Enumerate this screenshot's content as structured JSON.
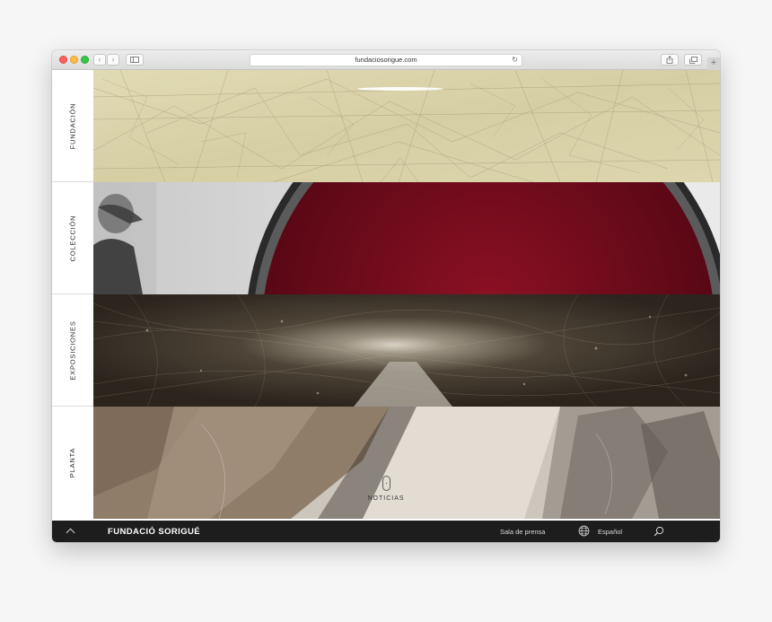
{
  "browser": {
    "url": "fundaciosorigue.com",
    "reload_glyph": "↻",
    "new_tab_glyph": "+",
    "back_glyph": "‹",
    "forward_glyph": "›"
  },
  "sidebar": {
    "items": [
      {
        "label": "FUNDACIÓN"
      },
      {
        "label": "COLECCIÓN"
      },
      {
        "label": "EXPOSICIONES"
      },
      {
        "label": "PLANTA"
      }
    ]
  },
  "scroll_hint": {
    "label": "NOTICIAS"
  },
  "footer": {
    "brand": "FUNDACIÓ SORIGUÉ",
    "press_link": "Sala de prensa",
    "language": "Español"
  },
  "icons": [
    "chevron-up-icon",
    "globe-icon",
    "search-icon",
    "mouse-scroll-icon",
    "share-icon",
    "tabs-icon",
    "sidebar-toggle-icon"
  ],
  "colors": {
    "footer_bg": "#1d1d1d",
    "panel_fundacion": "#d9d2a8",
    "panel_coleccion_red": "#6e0b1a",
    "panel_exposiciones": "#4a4137",
    "panel_planta": "#c9c1b6"
  }
}
